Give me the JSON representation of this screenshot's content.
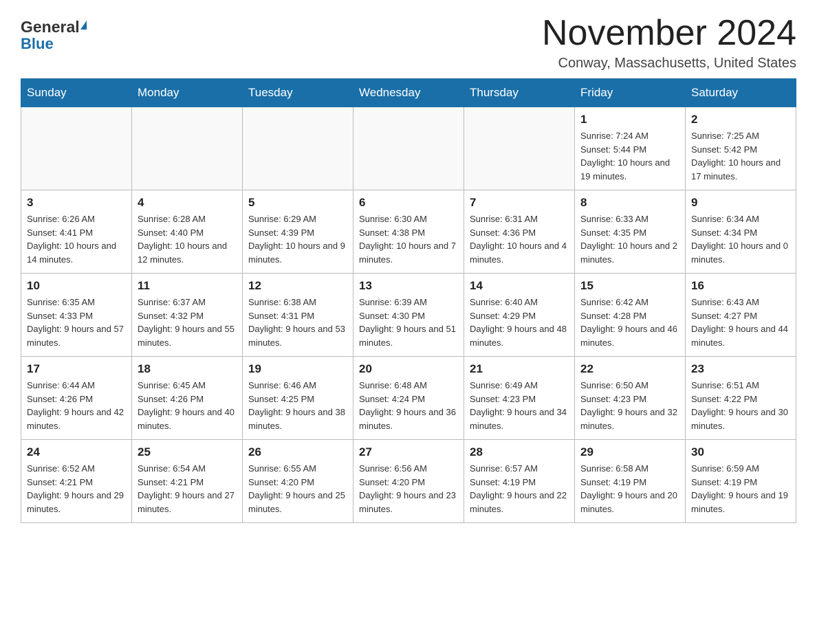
{
  "header": {
    "logo_general": "General",
    "logo_blue": "Blue",
    "month_title": "November 2024",
    "location": "Conway, Massachusetts, United States"
  },
  "days_of_week": [
    "Sunday",
    "Monday",
    "Tuesday",
    "Wednesday",
    "Thursday",
    "Friday",
    "Saturday"
  ],
  "weeks": [
    {
      "days": [
        {
          "number": "",
          "info": ""
        },
        {
          "number": "",
          "info": ""
        },
        {
          "number": "",
          "info": ""
        },
        {
          "number": "",
          "info": ""
        },
        {
          "number": "",
          "info": ""
        },
        {
          "number": "1",
          "info": "Sunrise: 7:24 AM\nSunset: 5:44 PM\nDaylight: 10 hours and 19 minutes."
        },
        {
          "number": "2",
          "info": "Sunrise: 7:25 AM\nSunset: 5:42 PM\nDaylight: 10 hours and 17 minutes."
        }
      ]
    },
    {
      "days": [
        {
          "number": "3",
          "info": "Sunrise: 6:26 AM\nSunset: 4:41 PM\nDaylight: 10 hours and 14 minutes."
        },
        {
          "number": "4",
          "info": "Sunrise: 6:28 AM\nSunset: 4:40 PM\nDaylight: 10 hours and 12 minutes."
        },
        {
          "number": "5",
          "info": "Sunrise: 6:29 AM\nSunset: 4:39 PM\nDaylight: 10 hours and 9 minutes."
        },
        {
          "number": "6",
          "info": "Sunrise: 6:30 AM\nSunset: 4:38 PM\nDaylight: 10 hours and 7 minutes."
        },
        {
          "number": "7",
          "info": "Sunrise: 6:31 AM\nSunset: 4:36 PM\nDaylight: 10 hours and 4 minutes."
        },
        {
          "number": "8",
          "info": "Sunrise: 6:33 AM\nSunset: 4:35 PM\nDaylight: 10 hours and 2 minutes."
        },
        {
          "number": "9",
          "info": "Sunrise: 6:34 AM\nSunset: 4:34 PM\nDaylight: 10 hours and 0 minutes."
        }
      ]
    },
    {
      "days": [
        {
          "number": "10",
          "info": "Sunrise: 6:35 AM\nSunset: 4:33 PM\nDaylight: 9 hours and 57 minutes."
        },
        {
          "number": "11",
          "info": "Sunrise: 6:37 AM\nSunset: 4:32 PM\nDaylight: 9 hours and 55 minutes."
        },
        {
          "number": "12",
          "info": "Sunrise: 6:38 AM\nSunset: 4:31 PM\nDaylight: 9 hours and 53 minutes."
        },
        {
          "number": "13",
          "info": "Sunrise: 6:39 AM\nSunset: 4:30 PM\nDaylight: 9 hours and 51 minutes."
        },
        {
          "number": "14",
          "info": "Sunrise: 6:40 AM\nSunset: 4:29 PM\nDaylight: 9 hours and 48 minutes."
        },
        {
          "number": "15",
          "info": "Sunrise: 6:42 AM\nSunset: 4:28 PM\nDaylight: 9 hours and 46 minutes."
        },
        {
          "number": "16",
          "info": "Sunrise: 6:43 AM\nSunset: 4:27 PM\nDaylight: 9 hours and 44 minutes."
        }
      ]
    },
    {
      "days": [
        {
          "number": "17",
          "info": "Sunrise: 6:44 AM\nSunset: 4:26 PM\nDaylight: 9 hours and 42 minutes."
        },
        {
          "number": "18",
          "info": "Sunrise: 6:45 AM\nSunset: 4:26 PM\nDaylight: 9 hours and 40 minutes."
        },
        {
          "number": "19",
          "info": "Sunrise: 6:46 AM\nSunset: 4:25 PM\nDaylight: 9 hours and 38 minutes."
        },
        {
          "number": "20",
          "info": "Sunrise: 6:48 AM\nSunset: 4:24 PM\nDaylight: 9 hours and 36 minutes."
        },
        {
          "number": "21",
          "info": "Sunrise: 6:49 AM\nSunset: 4:23 PM\nDaylight: 9 hours and 34 minutes."
        },
        {
          "number": "22",
          "info": "Sunrise: 6:50 AM\nSunset: 4:23 PM\nDaylight: 9 hours and 32 minutes."
        },
        {
          "number": "23",
          "info": "Sunrise: 6:51 AM\nSunset: 4:22 PM\nDaylight: 9 hours and 30 minutes."
        }
      ]
    },
    {
      "days": [
        {
          "number": "24",
          "info": "Sunrise: 6:52 AM\nSunset: 4:21 PM\nDaylight: 9 hours and 29 minutes."
        },
        {
          "number": "25",
          "info": "Sunrise: 6:54 AM\nSunset: 4:21 PM\nDaylight: 9 hours and 27 minutes."
        },
        {
          "number": "26",
          "info": "Sunrise: 6:55 AM\nSunset: 4:20 PM\nDaylight: 9 hours and 25 minutes."
        },
        {
          "number": "27",
          "info": "Sunrise: 6:56 AM\nSunset: 4:20 PM\nDaylight: 9 hours and 23 minutes."
        },
        {
          "number": "28",
          "info": "Sunrise: 6:57 AM\nSunset: 4:19 PM\nDaylight: 9 hours and 22 minutes."
        },
        {
          "number": "29",
          "info": "Sunrise: 6:58 AM\nSunset: 4:19 PM\nDaylight: 9 hours and 20 minutes."
        },
        {
          "number": "30",
          "info": "Sunrise: 6:59 AM\nSunset: 4:19 PM\nDaylight: 9 hours and 19 minutes."
        }
      ]
    }
  ]
}
